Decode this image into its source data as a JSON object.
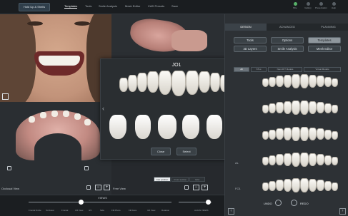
{
  "topbar": {
    "mode_button": "Hold Up & Shells",
    "menu": [
      "Templates",
      "Tools",
      "Smile Analysis",
      "Mesh Editor",
      "CAD Presets",
      "Save"
    ],
    "active_menu_index": 0,
    "tools": [
      "Bite",
      "Gallery",
      "Presentation",
      "Help"
    ]
  },
  "views": {
    "occlusal_label": "Occlusal View",
    "free_label": "Free View",
    "zoom_minus": "−",
    "zoom_plus": "+",
    "position_buttons": [
      "Jaw position",
      "Cross section",
      "Grid"
    ],
    "active_position_index": 0
  },
  "modal": {
    "title": "JO1",
    "prev": "‹",
    "next": "›",
    "close_label": "Close",
    "select_label": "Select"
  },
  "panel": {
    "tabs": [
      "DESIGN",
      "ADVANCED",
      "PLANNING"
    ],
    "active_tab_index": 0,
    "buttons": {
      "tools": "Tools",
      "options": "Options",
      "templates": "Templates",
      "layers": "3D Layers",
      "smile_analysis": "Smile Analysis",
      "mesh_editor": "Mesh Editor"
    },
    "subtabs": [
      "All",
      "STLs",
      "Non-DFT Models",
      "Virtual Models"
    ],
    "active_subtab_index": 0,
    "toggles": [
      "Preview",
      "Select"
    ],
    "active_toggle_index": 0,
    "library": [
      {
        "label": ""
      },
      {
        "label": ""
      },
      {
        "label": ""
      },
      {
        "label": "AL"
      },
      {
        "label": "FO1"
      }
    ],
    "undo_label": "UNDO",
    "redo_label": "REDO",
    "left_arrow": "‹",
    "right_arrow": "›"
  },
  "bottom": {
    "views_label": "VIEWS",
    "left_ticks": [
      "Frontal Smile",
      "Occlusal",
      "Frontal",
      "3/4 View",
      "3/4",
      "Side",
      "Fill Photo",
      "Fill Face",
      "3/4 View",
      "Rotation"
    ],
    "right_label": "ALIGN VIEWS"
  }
}
